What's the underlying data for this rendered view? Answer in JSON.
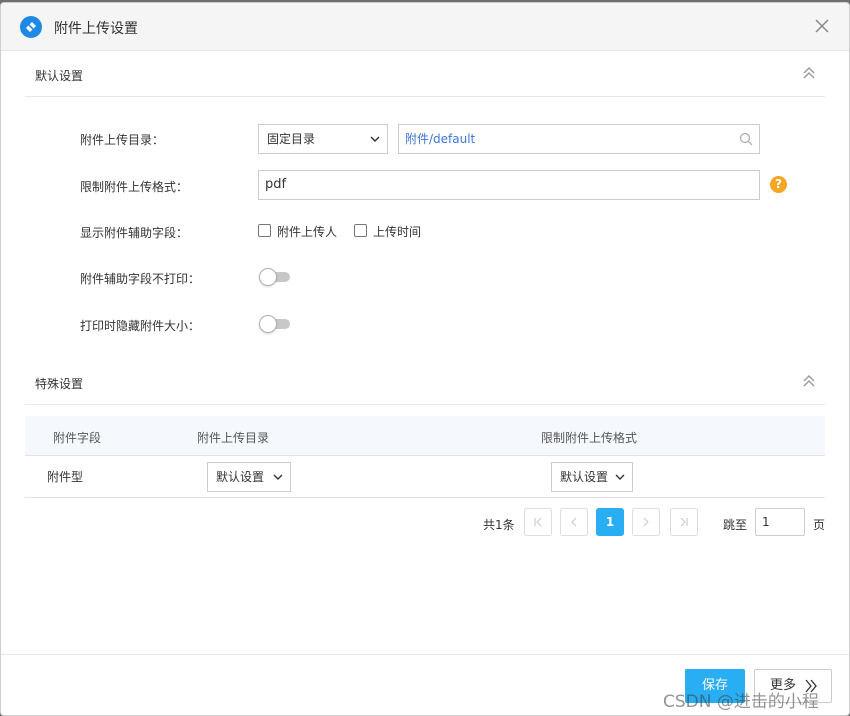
{
  "dialog": {
    "title": "附件上传设置",
    "icon": "app-logo-icon",
    "close_icon": "close-icon"
  },
  "default_section": {
    "title": "默认设置",
    "fields": {
      "upload_dir_label": "附件上传目录：",
      "upload_dir_mode": "固定目录",
      "upload_dir_path": "附件/default",
      "format_label": "限制附件上传格式：",
      "format_value": "pdf",
      "help": "?",
      "aux_fields_label": "显示附件辅助字段：",
      "aux_uploader": "附件上传人",
      "aux_upload_time": "上传时间",
      "no_print_label": "附件辅助字段不打印：",
      "hide_size_label": "打印时隐藏附件大小："
    }
  },
  "special_section": {
    "title": "特殊设置",
    "table": {
      "headers": [
        "附件字段",
        "附件上传目录",
        "限制附件上传格式"
      ],
      "rows": [
        {
          "field": "附件型",
          "dir": "默认设置",
          "format": "默认设置"
        }
      ]
    },
    "pagination": {
      "total": "共1条",
      "current_page": "1",
      "jump_label": "跳至",
      "jump_value": "1",
      "page_unit": "页"
    }
  },
  "footer": {
    "save": "保存",
    "more": "更多"
  },
  "watermark": "CSDN @进击的小程",
  "colors": {
    "primary": "#29aef4",
    "help": "#f5a623",
    "link": "#3c76d6"
  }
}
